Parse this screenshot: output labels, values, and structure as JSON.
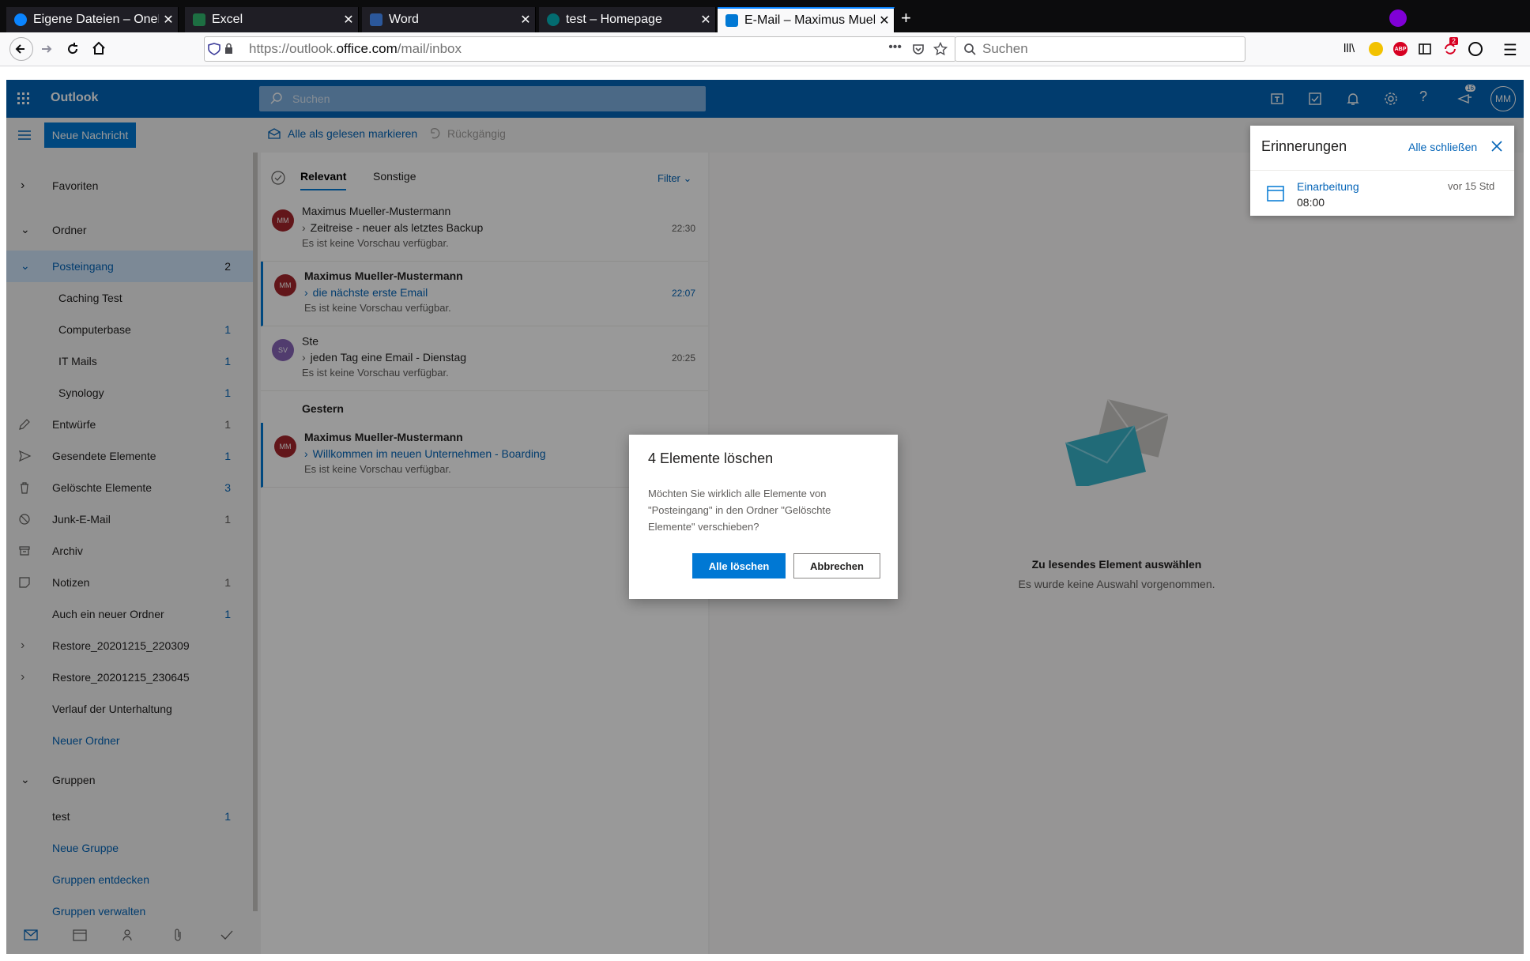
{
  "browser": {
    "tabs": [
      {
        "label": "Eigene Dateien – OneDri",
        "icon_color": "#0a84ff"
      },
      {
        "label": "Excel",
        "icon_color": "#1d6f42"
      },
      {
        "label": "Word",
        "icon_color": "#2b579a"
      },
      {
        "label": "test – Homepage",
        "icon_color": "#036c70"
      },
      {
        "label": "E-Mail – Maximus Muelle",
        "icon_color": "#0078d4",
        "active": true
      }
    ],
    "new_tab": "+",
    "url_prefix": "https://outlook.",
    "url_domain": "office.com",
    "url_path": "/mail/inbox",
    "search_placeholder": "Suchen",
    "badge_count": "2"
  },
  "outlook": {
    "brand": "Outlook",
    "search_placeholder": "Suchen",
    "avatar_initials": "MM",
    "notification_count": "16",
    "new_message": "Neue Nachricht",
    "mark_all_read": "Alle als gelesen markieren",
    "undo": "Rückgängig",
    "colors": {
      "brand": "#0364b8",
      "accent": "#0078d4"
    }
  },
  "folders": {
    "favorites": "Favoriten",
    "folders_header": "Ordner",
    "inbox": {
      "label": "Posteingang",
      "count": "2"
    },
    "subfolders": [
      {
        "label": "Caching Test",
        "count": ""
      },
      {
        "label": "Computerbase",
        "count": "1"
      },
      {
        "label": "IT Mails",
        "count": "1"
      },
      {
        "label": "Synology",
        "count": "1"
      }
    ],
    "items": [
      {
        "label": "Entwürfe",
        "count": "1",
        "icon": "pencil-icon"
      },
      {
        "label": "Gesendete Elemente",
        "count": "1",
        "icon": "send-icon"
      },
      {
        "label": "Gelöschte Elemente",
        "count": "3",
        "icon": "trash-icon"
      },
      {
        "label": "Junk-E-Mail",
        "count": "1",
        "icon": "block-icon"
      },
      {
        "label": "Archiv",
        "count": "",
        "icon": "archive-icon"
      },
      {
        "label": "Notizen",
        "count": "1",
        "icon": "note-icon"
      },
      {
        "label": "Auch ein neuer Ordner",
        "count": "1",
        "icon": ""
      },
      {
        "label": "Restore_20201215_220309",
        "count": "",
        "icon": "chevron-right-icon"
      },
      {
        "label": "Restore_20201215_230645",
        "count": "",
        "icon": "chevron-right-icon"
      },
      {
        "label": "Verlauf der Unterhaltung",
        "count": "",
        "icon": ""
      }
    ],
    "new_folder": "Neuer Ordner",
    "groups_header": "Gruppen",
    "group_test": {
      "label": "test",
      "count": "1"
    },
    "new_group": "Neue Gruppe",
    "discover_groups": "Gruppen entdecken",
    "manage_groups": "Gruppen verwalten"
  },
  "message_list": {
    "tab_focused": "Relevant",
    "tab_other": "Sonstige",
    "filter": "Filter",
    "yesterday": "Gestern",
    "messages": [
      {
        "initials": "MM",
        "from": "Maximus Mueller-Mustermann",
        "subject": "Zeitreise - neuer als letztes Backup",
        "preview": "Es ist keine Vorschau verfügbar.",
        "time": "22:30",
        "avatar_color": "#a4262c"
      },
      {
        "initials": "MM",
        "from": "Maximus Mueller-Mustermann",
        "subject": "die nächste erste Email",
        "preview": "Es ist keine Vorschau verfügbar.",
        "time": "22:07",
        "avatar_color": "#a4262c"
      },
      {
        "initials": "SV",
        "from": "Ste",
        "subject": "jeden Tag eine Email - Dienstag",
        "preview": "Es ist keine Vorschau verfügbar.",
        "time": "20:25",
        "avatar_color": "#8764b8"
      },
      {
        "initials": "MM",
        "from": "Maximus Mueller-Mustermann",
        "subject": "Willkommen im neuen Unternehmen - Boarding",
        "preview": "Es ist keine Vorschau verfügbar.",
        "time": "",
        "avatar_color": "#a4262c"
      }
    ]
  },
  "reading_pane": {
    "empty_title": "Zu lesendes Element auswählen",
    "empty_sub": "Es wurde keine Auswahl vorgenommen."
  },
  "reminders": {
    "title": "Erinnerungen",
    "dismiss_all": "Alle schließen",
    "item_title": "Einarbeitung",
    "item_time": "08:00",
    "item_due": "vor 15 Std"
  },
  "dialog": {
    "title": "4 Elemente löschen",
    "body": "Möchten Sie wirklich alle Elemente von \"Posteingang\" in den Ordner \"Gelöschte Elemente\" verschieben?",
    "confirm": "Alle löschen",
    "cancel": "Abbrechen"
  }
}
